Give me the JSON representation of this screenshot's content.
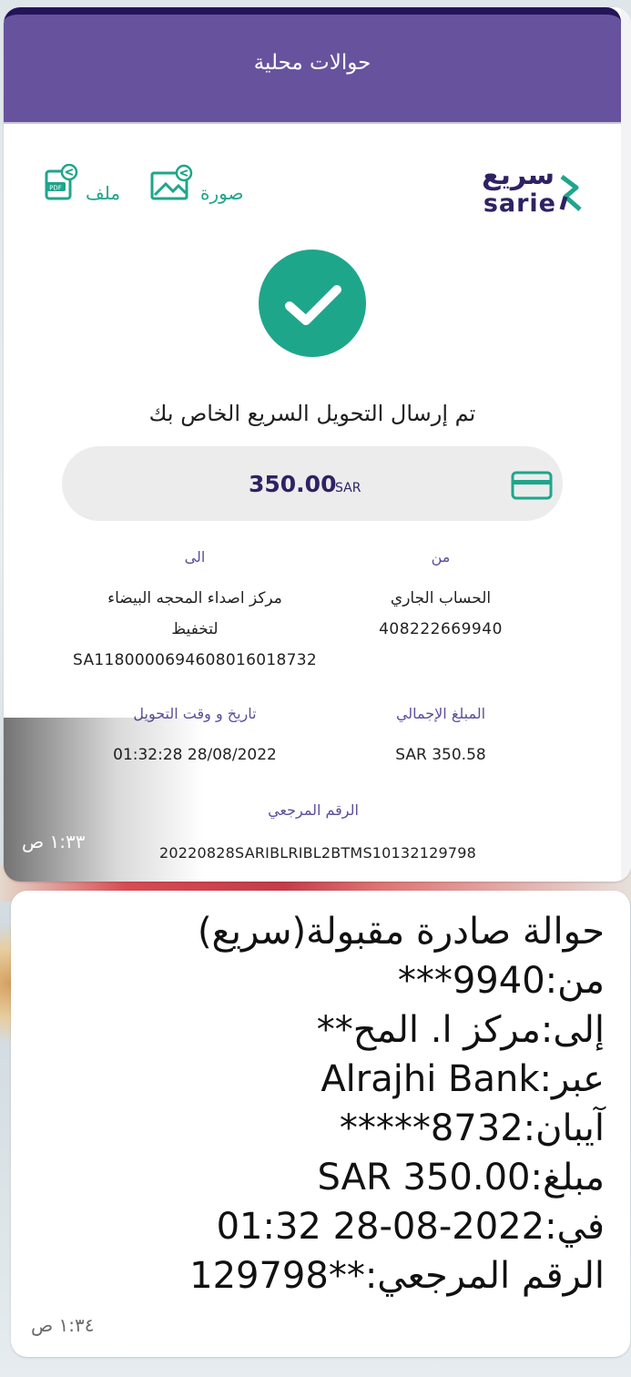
{
  "header": {
    "title": "حوالات محلية"
  },
  "brand": {
    "arabic": "سريع",
    "latin": "sarie"
  },
  "share": {
    "image_label": "صورة",
    "file_label": "ملف"
  },
  "status": {
    "message": "تم إرسال التحويل السريع الخاص بك"
  },
  "amount": {
    "value": "350.00",
    "currency": "SAR"
  },
  "details": {
    "from_label": "من",
    "from_account_name": "الحساب الجاري",
    "from_account_number": "408222669940",
    "to_label": "الى",
    "to_name_line1": "مركز اصداء المحجه البيضاء",
    "to_name_line2": "لتخفيظ",
    "to_iban": "SA1180000694608016018732",
    "total_label": "المبلغ الإجمالي",
    "total_value": "SAR 350.58",
    "datetime_label": "تاريخ و وقت التحويل",
    "datetime_value": "01:32:28 28/08/2022",
    "reference_label": "الرقم المرجعي",
    "reference_value": "20220828SARIBLRIBL2BTMS10132129798"
  },
  "message1_time": "١:٣٣ ص",
  "sms": {
    "lines": [
      "حوالة صادرة مقبولة(سريع)",
      "من:9940***",
      "إلى:مركز ا. المح**",
      "عبر:Alrajhi Bank",
      "آيبان:8732*****",
      "مبلغ:SAR 350.00",
      "في:2022-08-28 01:32",
      "الرقم المرجعي:**129798"
    ],
    "time": "١:٣٤ ص"
  },
  "colors": {
    "header": "#67539d",
    "accent_green": "#1ea68b",
    "brand_navy": "#2f2264"
  }
}
